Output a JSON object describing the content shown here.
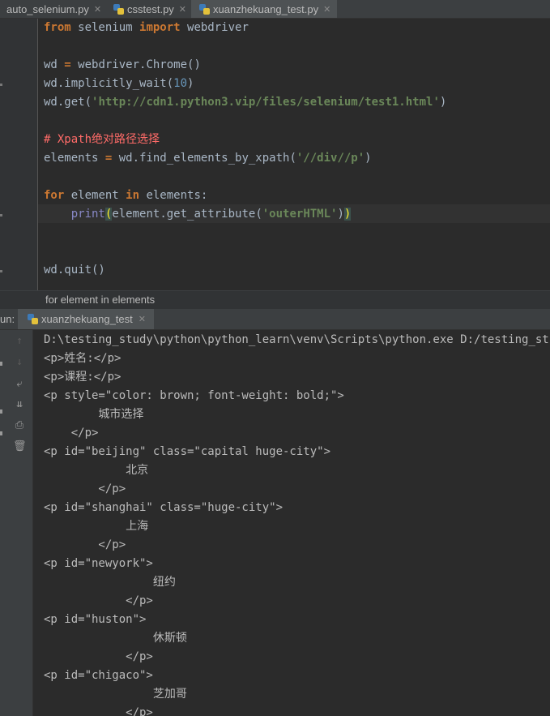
{
  "tabs": [
    {
      "label": "auto_selenium.py",
      "active": false
    },
    {
      "label": "csstest.py",
      "active": false
    },
    {
      "label": "xuanzhekuang_test.py",
      "active": true
    }
  ],
  "code": {
    "l1": {
      "a": "from",
      "b": " selenium ",
      "c": "import",
      "d": " webdriver"
    },
    "l3": {
      "a": "wd ",
      "b": "=",
      "c": " webdriver.Chrome()"
    },
    "l4": {
      "a": "wd.implicitly_wait(",
      "b": "10",
      "c": ")"
    },
    "l5": {
      "a": "wd.get(",
      "b": "'http://cdn1.python3.vip/files/selenium/test1.html'",
      "c": ")"
    },
    "l7": {
      "a": "# Xpath绝对路径选择"
    },
    "l8": {
      "a": "elements ",
      "b": "=",
      "c": " wd.find_elements_by_xpath(",
      "d": "'//div//p'",
      "e": ")"
    },
    "l10": {
      "a": "for",
      "b": " element ",
      "c": "in",
      "d": " elements:"
    },
    "l11": {
      "a": "    ",
      "b": "print",
      "c": "(",
      "d": "element.get_attribute(",
      "e": "'outerHTML'",
      "f": ")",
      "g": ")"
    },
    "l14": {
      "a": "wd.quit()"
    }
  },
  "breadcrumb": "for element in elements",
  "run": {
    "label": "un:",
    "tab": "xuanzhekuang_test"
  },
  "output": [
    "D:\\testing_study\\python\\python_learn\\venv\\Scripts\\python.exe D:/testing_study/",
    "<p>姓名:</p>",
    "<p>课程:</p>",
    "<p style=\"color: brown; font-weight: bold;\">",
    "        城市选择",
    "    </p>",
    "<p id=\"beijing\" class=\"capital huge-city\">",
    "            北京",
    "        </p>",
    "<p id=\"shanghai\" class=\"huge-city\">",
    "            上海",
    "        </p>",
    "<p id=\"newyork\">",
    "                纽约",
    "            </p>",
    "<p id=\"huston\">",
    "                休斯顿",
    "            </p>",
    "<p id=\"chigaco\">",
    "                芝加哥",
    "            </p>"
  ],
  "colors": {
    "keyword": "#cc7832",
    "string": "#6a8759",
    "number": "#6897bb",
    "comment": "#ff6b68",
    "builtin": "#8888c6",
    "text": "#a9b7c6"
  }
}
